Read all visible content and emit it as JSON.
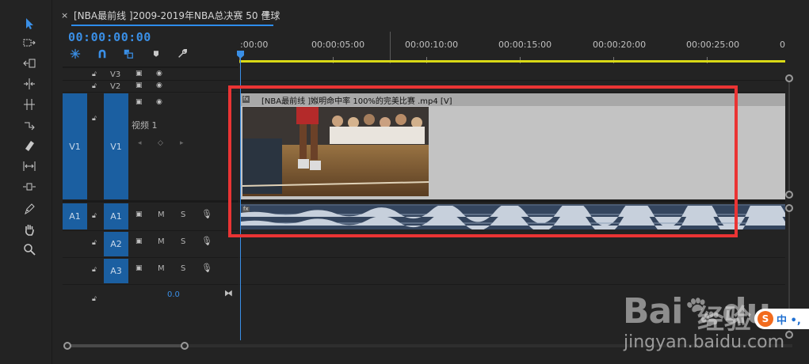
{
  "tab": {
    "close_glyph": "×",
    "title": "[NBA最前线 ]2009-2019年NBA总决赛 50 佳球",
    "menu_glyph": "≡"
  },
  "timecode": "00:00:00:00",
  "ruler": {
    "labels": [
      ":00:00",
      "00:00:05:00",
      "00:00:10:00",
      "00:00:15:00",
      "00:00:20:00",
      "00:00:25:00",
      "0"
    ]
  },
  "tracks": {
    "video": [
      {
        "name": "V3"
      },
      {
        "name": "V2"
      },
      {
        "source": "V1",
        "name": "V1",
        "sub_label": "视频 1"
      }
    ],
    "audio": [
      {
        "source": "A1",
        "name": "A1",
        "m": "M",
        "s": "S"
      },
      {
        "name": "A2",
        "m": "M",
        "s": "S"
      },
      {
        "name": "A3",
        "m": "M",
        "s": "S"
      }
    ],
    "master_value": "0.0"
  },
  "clip": {
    "badge": "fx",
    "title": "[NBA最前线 ]娰明命中率 100%的完美比赛 .mp4 [V]",
    "audio_badge": "fx"
  },
  "watermark": {
    "brand": "Bai",
    "brand2": "du",
    "jingyan": "经验",
    "url": "jingyan.baidu.com",
    "badge_s": "S",
    "badge_zh": "中 •,"
  },
  "colors": {
    "accent": "#3a8fe6",
    "target_blue": "#1b5fa1",
    "highlight_red": "#ea3434",
    "work_area_yellow": "#d9d916"
  }
}
